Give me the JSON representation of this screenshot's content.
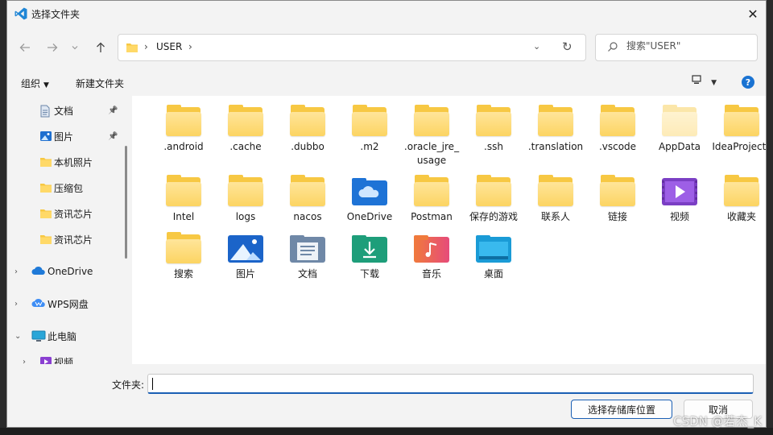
{
  "window": {
    "title": "选择文件夹",
    "close_glyph": "✕"
  },
  "nav": {
    "back_icon": "arrow-left-icon",
    "forward_icon": "arrow-right-icon",
    "recent_icon": "chevron-down-icon",
    "up_icon": "arrow-up-icon",
    "breadcrumb_current": "USER",
    "search_placeholder": "搜索\"USER\""
  },
  "commands": {
    "organize": "组织",
    "new_folder": "新建文件夹",
    "help": "?"
  },
  "sidebar": {
    "items": [
      {
        "label": "文档",
        "icon": "document-icon",
        "pinned": true
      },
      {
        "label": "图片",
        "icon": "picture-icon",
        "pinned": true
      },
      {
        "label": "本机照片",
        "icon": "folder-icon"
      },
      {
        "label": "压缩包",
        "icon": "folder-icon"
      },
      {
        "label": "资讯芯片",
        "icon": "folder-icon"
      },
      {
        "label": "资讯芯片",
        "icon": "folder-icon"
      },
      {
        "label": "OneDrive",
        "icon": "cloud-icon"
      },
      {
        "label": "WPS网盘",
        "icon": "wps-cloud-icon"
      },
      {
        "label": "此电脑",
        "icon": "computer-icon"
      },
      {
        "label": "视频",
        "icon": "video-icon"
      }
    ]
  },
  "content": {
    "items": [
      {
        "label": ".android",
        "kind": "folder"
      },
      {
        "label": ".cache",
        "kind": "folder"
      },
      {
        "label": ".dubbo",
        "kind": "folder"
      },
      {
        "label": ".m2",
        "kind": "folder"
      },
      {
        "label": ".oracle_jre_usage",
        "kind": "folder"
      },
      {
        "label": ".ssh",
        "kind": "folder"
      },
      {
        "label": ".translation",
        "kind": "folder"
      },
      {
        "label": ".vscode",
        "kind": "folder"
      },
      {
        "label": "AppData",
        "kind": "folder-hidden"
      },
      {
        "label": "IdeaProjects",
        "kind": "folder"
      },
      {
        "label": "Intel",
        "kind": "folder"
      },
      {
        "label": "logs",
        "kind": "folder"
      },
      {
        "label": "nacos",
        "kind": "folder"
      },
      {
        "label": "OneDrive",
        "kind": "onedrive"
      },
      {
        "label": "Postman",
        "kind": "folder"
      },
      {
        "label": "保存的游戏",
        "kind": "folder"
      },
      {
        "label": "联系人",
        "kind": "folder"
      },
      {
        "label": "链接",
        "kind": "folder"
      },
      {
        "label": "视频",
        "kind": "videos"
      },
      {
        "label": "收藏夹",
        "kind": "folder"
      },
      {
        "label": "搜索",
        "kind": "folder"
      },
      {
        "label": "图片",
        "kind": "pictures"
      },
      {
        "label": "文档",
        "kind": "documents"
      },
      {
        "label": "下载",
        "kind": "downloads"
      },
      {
        "label": "音乐",
        "kind": "music"
      },
      {
        "label": "桌面",
        "kind": "desktop"
      }
    ]
  },
  "footer": {
    "folder_label": "文件夹:",
    "folder_value": "",
    "select_button": "选择存储库位置",
    "cancel_button": "取消"
  },
  "watermark": "CSDN @若杰_K",
  "colors": {
    "accent": "#1a5fb4",
    "folder": "#f7c843"
  }
}
